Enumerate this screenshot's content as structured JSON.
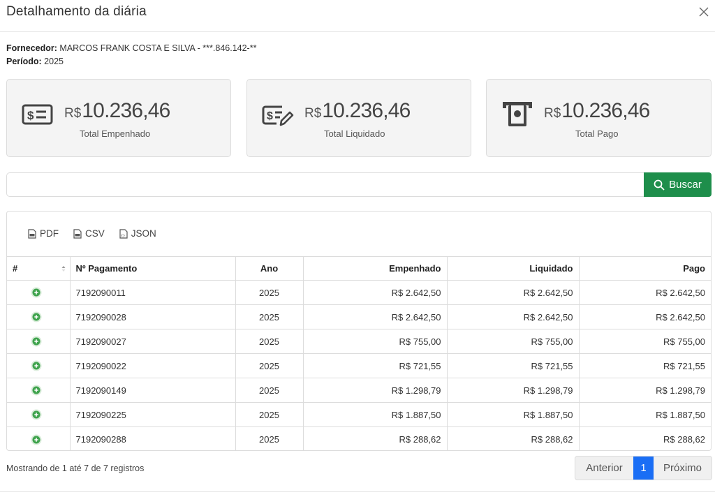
{
  "modal": {
    "title": "Detalhamento da diária"
  },
  "meta": {
    "fornecedor_label": "Fornecedor:",
    "fornecedor_value": " MARCOS FRANK COSTA E SILVA - ***.846.142-**",
    "periodo_label": "Período:",
    "periodo_value": " 2025"
  },
  "cards": [
    {
      "prefix": "R$",
      "value": "10.236,46",
      "label": "Total Empenhado",
      "icon": "money-bill-icon"
    },
    {
      "prefix": "R$",
      "value": "10.236,46",
      "label": "Total Liquidado",
      "icon": "money-check-pen-icon"
    },
    {
      "prefix": "R$",
      "value": "10.236,46",
      "label": "Total Pago",
      "icon": "cash-register-icon"
    }
  ],
  "search": {
    "value": "",
    "placeholder": "",
    "button_label": "Buscar"
  },
  "export": {
    "pdf": "PDF",
    "csv": "CSV",
    "json": "JSON"
  },
  "table": {
    "headers": {
      "num": "#",
      "pagamento": "Nº Pagamento",
      "ano": "Ano",
      "empenhado": "Empenhado",
      "liquidado": "Liquidado",
      "pago": "Pago"
    },
    "rows": [
      {
        "pagamento": "7192090011",
        "ano": "2025",
        "empenhado": "R$ 2.642,50",
        "liquidado": "R$ 2.642,50",
        "pago": "R$ 2.642,50"
      },
      {
        "pagamento": "7192090028",
        "ano": "2025",
        "empenhado": "R$ 2.642,50",
        "liquidado": "R$ 2.642,50",
        "pago": "R$ 2.642,50"
      },
      {
        "pagamento": "7192090027",
        "ano": "2025",
        "empenhado": "R$ 755,00",
        "liquidado": "R$ 755,00",
        "pago": "R$ 755,00"
      },
      {
        "pagamento": "7192090022",
        "ano": "2025",
        "empenhado": "R$ 721,55",
        "liquidado": "R$ 721,55",
        "pago": "R$ 721,55"
      },
      {
        "pagamento": "7192090149",
        "ano": "2025",
        "empenhado": "R$ 1.298,79",
        "liquidado": "R$ 1.298,79",
        "pago": "R$ 1.298,79"
      },
      {
        "pagamento": "7192090225",
        "ano": "2025",
        "empenhado": "R$ 1.887,50",
        "liquidado": "R$ 1.887,50",
        "pago": "R$ 1.887,50"
      },
      {
        "pagamento": "7192090288",
        "ano": "2025",
        "empenhado": "R$ 288,62",
        "liquidado": "R$ 288,62",
        "pago": "R$ 288,62"
      }
    ]
  },
  "footer": {
    "info": "Mostrando de 1 até 7 de 7 registros",
    "prev": "Anterior",
    "current_page": "1",
    "next": "Próximo"
  },
  "colors": {
    "accent": "#1e8e4b",
    "page_active": "#1a6ef5",
    "row_icon": "#3fa34d"
  }
}
